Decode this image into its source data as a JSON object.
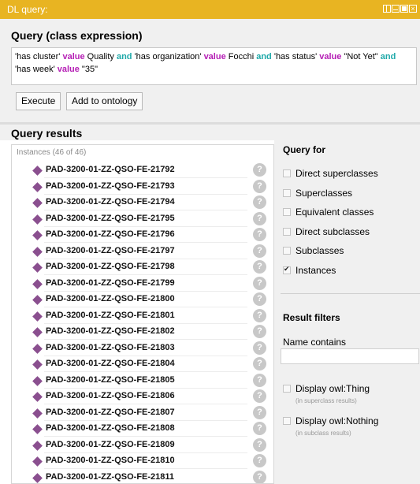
{
  "window": {
    "title": "DL query:"
  },
  "query": {
    "heading": "Query (class expression)",
    "parts": [
      {
        "t": "'has cluster' ",
        "k": ""
      },
      {
        "t": "value",
        "k": "v"
      },
      {
        "t": " Quality ",
        "k": ""
      },
      {
        "t": "and",
        "k": "a"
      },
      {
        "t": " 'has organization' ",
        "k": ""
      },
      {
        "t": "value",
        "k": "v"
      },
      {
        "t": " Focchi ",
        "k": ""
      },
      {
        "t": "and",
        "k": "a"
      },
      {
        "t": " 'has status' ",
        "k": ""
      },
      {
        "t": "value",
        "k": "v"
      },
      {
        "t": " \"Not Yet\" ",
        "k": ""
      },
      {
        "t": "and",
        "k": "a"
      },
      {
        "t": " 'has week' ",
        "k": ""
      },
      {
        "t": "value",
        "k": "v"
      },
      {
        "t": " \"35\"",
        "k": ""
      }
    ],
    "execute_label": "Execute",
    "add_label": "Add to ontology"
  },
  "results": {
    "heading": "Query results",
    "instances_label": "Instances (46 of 46)",
    "items": [
      "PAD-3200-01-ZZ-QSO-FE-21792",
      "PAD-3200-01-ZZ-QSO-FE-21793",
      "PAD-3200-01-ZZ-QSO-FE-21794",
      "PAD-3200-01-ZZ-QSO-FE-21795",
      "PAD-3200-01-ZZ-QSO-FE-21796",
      "PAD-3200-01-ZZ-QSO-FE-21797",
      "PAD-3200-01-ZZ-QSO-FE-21798",
      "PAD-3200-01-ZZ-QSO-FE-21799",
      "PAD-3200-01-ZZ-QSO-FE-21800",
      "PAD-3200-01-ZZ-QSO-FE-21801",
      "PAD-3200-01-ZZ-QSO-FE-21802",
      "PAD-3200-01-ZZ-QSO-FE-21803",
      "PAD-3200-01-ZZ-QSO-FE-21804",
      "PAD-3200-01-ZZ-QSO-FE-21805",
      "PAD-3200-01-ZZ-QSO-FE-21806",
      "PAD-3200-01-ZZ-QSO-FE-21807",
      "PAD-3200-01-ZZ-QSO-FE-21808",
      "PAD-3200-01-ZZ-QSO-FE-21809",
      "PAD-3200-01-ZZ-QSO-FE-21810",
      "PAD-3200-01-ZZ-QSO-FE-21811"
    ],
    "hint_glyph": "?",
    "item_icon": "individual-diamond-icon"
  },
  "query_for": {
    "heading": "Query for",
    "options": [
      {
        "label": "Direct superclasses",
        "checked": false
      },
      {
        "label": "Superclasses",
        "checked": false
      },
      {
        "label": "Equivalent classes",
        "checked": false
      },
      {
        "label": "Direct subclasses",
        "checked": false
      },
      {
        "label": "Subclasses",
        "checked": false
      },
      {
        "label": "Instances",
        "checked": true
      }
    ]
  },
  "filters": {
    "heading": "Result filters",
    "name_contains_label": "Name contains",
    "name_contains_value": "",
    "display_thing": {
      "label": "Display owl:Thing",
      "sub": "(in superclass results)",
      "checked": false
    },
    "display_nothing": {
      "label": "Display owl:Nothing",
      "sub": "(in subclass results)",
      "checked": false
    }
  },
  "colors": {
    "titlebar": "#e8b422",
    "value_keyword": "#b51eb5",
    "and_keyword": "#1fa9a9",
    "individual_icon": "#8a4f8f"
  }
}
